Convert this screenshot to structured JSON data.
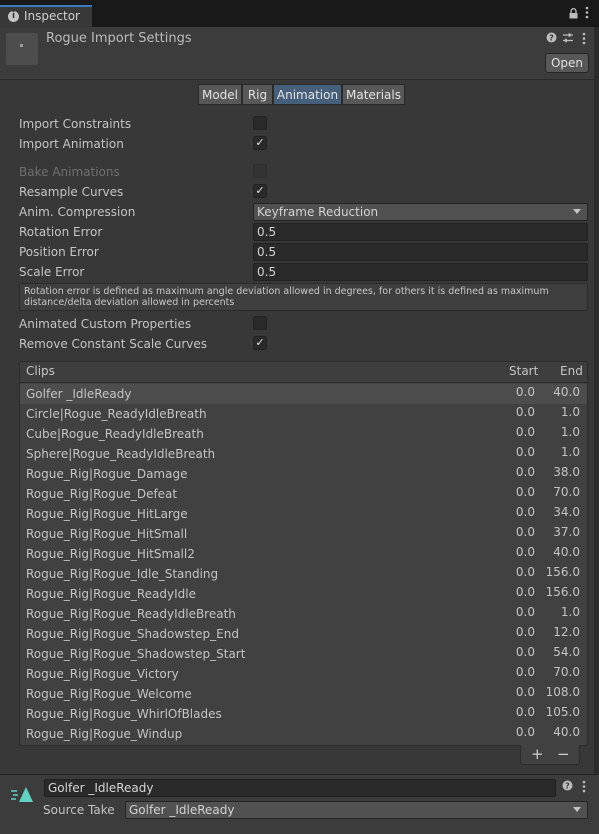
{
  "window": {
    "tab_label": "Inspector",
    "title": "Rogue Import Settings",
    "open_label": "Open",
    "icons": [
      "info-icon",
      "lock-icon",
      "menu-icon",
      "help-icon",
      "preset-icon"
    ]
  },
  "tabs": [
    {
      "label": "Model",
      "active": false
    },
    {
      "label": "Rig",
      "active": false
    },
    {
      "label": "Animation",
      "active": true
    },
    {
      "label": "Materials",
      "active": false
    }
  ],
  "settings": {
    "import_constraints": {
      "label": "Import Constraints",
      "checked": false
    },
    "import_animation": {
      "label": "Import Animation",
      "checked": true
    },
    "bake_animations": {
      "label": "Bake Animations",
      "checked": false,
      "disabled": true
    },
    "resample_curves": {
      "label": "Resample Curves",
      "checked": true
    },
    "anim_compression": {
      "label": "Anim. Compression",
      "value": "Keyframe Reduction"
    },
    "rotation_error": {
      "label": "Rotation Error",
      "value": "0.5"
    },
    "position_error": {
      "label": "Position Error",
      "value": "0.5"
    },
    "scale_error": {
      "label": "Scale Error",
      "value": "0.5"
    },
    "help_text": "Rotation error is defined as maximum angle deviation allowed in degrees, for others it is defined as maximum distance/delta deviation allowed in percents",
    "animated_custom_properties": {
      "label": "Animated Custom Properties",
      "checked": false
    },
    "remove_constant_scale_curves": {
      "label": "Remove Constant Scale Curves",
      "checked": true
    }
  },
  "clips": {
    "header": {
      "name": "Clips",
      "start": "Start",
      "end": "End"
    },
    "rows": [
      {
        "name": "Golfer _IdleReady",
        "start": "0.0",
        "end": "40.0",
        "selected": true
      },
      {
        "name": "Circle|Rogue_ReadyIdleBreath",
        "start": "0.0",
        "end": "1.0"
      },
      {
        "name": "Cube|Rogue_ReadyIdleBreath",
        "start": "0.0",
        "end": "1.0"
      },
      {
        "name": "Sphere|Rogue_ReadyIdleBreath",
        "start": "0.0",
        "end": "1.0"
      },
      {
        "name": "Rogue_Rig|Rogue_Damage",
        "start": "0.0",
        "end": "38.0"
      },
      {
        "name": "Rogue_Rig|Rogue_Defeat",
        "start": "0.0",
        "end": "70.0"
      },
      {
        "name": "Rogue_Rig|Rogue_HitLarge",
        "start": "0.0",
        "end": "34.0"
      },
      {
        "name": "Rogue_Rig|Rogue_HitSmall",
        "start": "0.0",
        "end": "37.0"
      },
      {
        "name": "Rogue_Rig|Rogue_HitSmall2",
        "start": "0.0",
        "end": "40.0"
      },
      {
        "name": "Rogue_Rig|Rogue_Idle_Standing",
        "start": "0.0",
        "end": "156.0"
      },
      {
        "name": "Rogue_Rig|Rogue_ReadyIdle",
        "start": "0.0",
        "end": "156.0"
      },
      {
        "name": "Rogue_Rig|Rogue_ReadyIdleBreath",
        "start": "0.0",
        "end": "1.0"
      },
      {
        "name": "Rogue_Rig|Rogue_Shadowstep_End",
        "start": "0.0",
        "end": "12.0"
      },
      {
        "name": "Rogue_Rig|Rogue_Shadowstep_Start",
        "start": "0.0",
        "end": "54.0"
      },
      {
        "name": "Rogue_Rig|Rogue_Victory",
        "start": "0.0",
        "end": "70.0"
      },
      {
        "name": "Rogue_Rig|Rogue_Welcome",
        "start": "0.0",
        "end": "108.0"
      },
      {
        "name": "Rogue_Rig|Rogue_WhirlOfBlades",
        "start": "0.0",
        "end": "105.0"
      },
      {
        "name": "Rogue_Rig|Rogue_Windup",
        "start": "0.0",
        "end": "40.0"
      }
    ],
    "add_label": "+",
    "remove_label": "−"
  },
  "clip_detail": {
    "name": "Golfer _IdleReady",
    "source_take_label": "Source Take",
    "source_take_value": "Golfer _IdleReady"
  },
  "colors": {
    "background": "#383838",
    "active_tab": "#46607c",
    "accent": "#3a79bb",
    "clip_icon": "#5fd3c3"
  }
}
